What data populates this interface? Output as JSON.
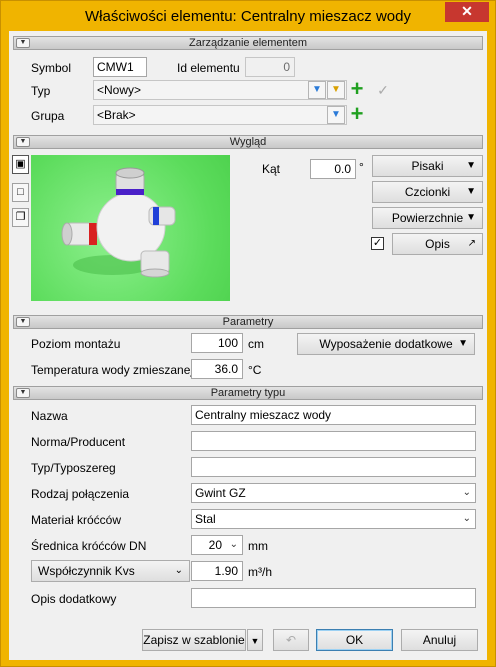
{
  "window": {
    "title": "Właściwości elementu: Centralny mieszacz wody",
    "close": "✕"
  },
  "sections": {
    "element": "Zarządzanie elementem",
    "appearance": "Wygląd",
    "params": "Parametry",
    "type_params": "Parametry typu"
  },
  "element": {
    "symbol_label": "Symbol",
    "symbol_value": "CMW1",
    "id_label": "Id elementu",
    "id_value": "0",
    "type_label": "Typ",
    "type_value": "<Nowy>",
    "group_label": "Grupa",
    "group_value": "<Brak>"
  },
  "appearance": {
    "angle_label": "Kąt",
    "angle_value": "0.0",
    "angle_unit": "°",
    "pens": "Pisaki",
    "fonts": "Czcionki",
    "surfaces": "Powierzchnie",
    "desc": "Opis",
    "desc_checked": true
  },
  "params": {
    "mount_label": "Poziom montażu",
    "mount_value": "100",
    "mount_unit": "cm",
    "temp_label": "Temperatura wody zmieszanej",
    "temp_value": "36.0",
    "temp_unit": "°C",
    "extra_equipment": "Wyposażenie dodatkowe"
  },
  "type_params": {
    "name_label": "Nazwa",
    "name_value": "Centralny mieszacz wody",
    "norm_label": "Norma/Producent",
    "norm_value": "",
    "series_label": "Typ/Typoszereg",
    "series_value": "",
    "conn_label": "Rodzaj połączenia",
    "conn_value": "Gwint GZ",
    "material_label": "Materiał króćców",
    "material_value": "Stal",
    "dn_label": "Średnica króćców DN",
    "dn_value": "20",
    "dn_unit": "mm",
    "kvs_label": "Współczynnik Kvs",
    "kvs_value": "1.90",
    "kvs_unit": "m³/h",
    "extra_label": "Opis dodatkowy",
    "extra_value": ""
  },
  "footer": {
    "save_template": "Zapisz w szablonie",
    "ok": "OK",
    "cancel": "Anuluj"
  },
  "colors": {
    "titlebar": "#f0b400",
    "preview_bg": "#5cdc5c",
    "add_icon": "#20a020",
    "close_btn": "#c7372f"
  }
}
